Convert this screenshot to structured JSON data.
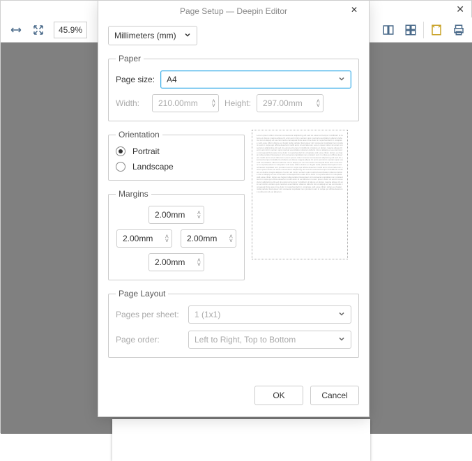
{
  "bg": {
    "zoom": "45.9%"
  },
  "dialog": {
    "title": "Page Setup — Deepin Editor",
    "units": "Millimeters (mm)",
    "paper": {
      "legend": "Paper",
      "page_size_label": "Page size:",
      "page_size_value": "A4",
      "width_label": "Width:",
      "width_value": "210.00mm",
      "height_label": "Height:",
      "height_value": "297.00mm"
    },
    "orientation": {
      "legend": "Orientation",
      "portrait": "Portrait",
      "landscape": "Landscape"
    },
    "margins": {
      "legend": "Margins",
      "top": "2.00mm",
      "left": "2.00mm",
      "right": "2.00mm",
      "bottom": "2.00mm"
    },
    "layout": {
      "legend": "Page Layout",
      "pps_label": "Pages per sheet:",
      "pps_value": "1 (1x1)",
      "order_label": "Page order:",
      "order_value": "Left to Right, Top to Bottom"
    },
    "ok": "OK",
    "cancel": "Cancel"
  }
}
